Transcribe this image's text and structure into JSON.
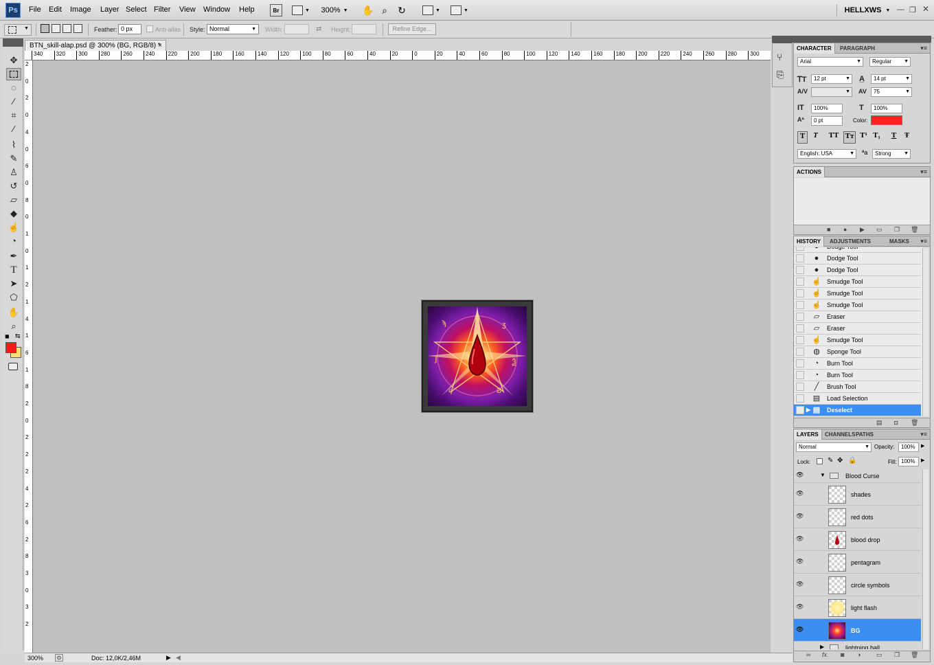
{
  "app": {
    "logo": "Ps",
    "user": "HELLXWS",
    "zoom": "300%"
  },
  "menu": [
    "File",
    "Edit",
    "Image",
    "Layer",
    "Select",
    "Filter",
    "View",
    "Window",
    "Help"
  ],
  "menubar_buttons": {
    "bridge": "Br"
  },
  "options": {
    "feather_label": "Feather:",
    "feather_value": "0 px",
    "antialias_label": "Anti-alias",
    "style_label": "Style:",
    "style_value": "Normal",
    "width_label": "Width:",
    "height_label": "Height:",
    "refine_edge": "Refine Edge..."
  },
  "document": {
    "tab_title": "BTN_skill-alap.psd @ 300% (BG, RGB/8) *",
    "close": "×"
  },
  "ruler": {
    "top": [
      "340",
      "320",
      "300",
      "280",
      "260",
      "240",
      "220",
      "200",
      "180",
      "160",
      "140",
      "120",
      "100",
      "80",
      "60",
      "40",
      "20",
      "0",
      "20",
      "40",
      "60",
      "80",
      "100",
      "120",
      "140",
      "160",
      "180",
      "200",
      "220",
      "240",
      "260",
      "280",
      "300"
    ],
    "left": [
      "2",
      "0",
      "2",
      "0",
      "4",
      "0",
      "6",
      "0",
      "8",
      "0",
      "1",
      "0",
      "1",
      "2",
      "1",
      "4",
      "1",
      "6",
      "1",
      "8",
      "2",
      "0",
      "2",
      "2",
      "2",
      "4",
      "2",
      "6",
      "2",
      "8",
      "3",
      "0",
      "3",
      "2"
    ]
  },
  "status": {
    "zoom": "300%",
    "doc": "Doc: 12,0K/2,46M"
  },
  "colors": {
    "foreground": "#ff1a1a",
    "background": "#ffe070",
    "selection": "#3c8ef0"
  },
  "character": {
    "tabs": [
      "CHARACTER",
      "PARAGRAPH"
    ],
    "font_family": "Arial",
    "font_style": "Regular",
    "size": "12 pt",
    "leading": "14 pt",
    "kerning": "",
    "tracking": "75",
    "vscale": "100%",
    "hscale": "100%",
    "baseline": "0 pt",
    "color_label": "Color:",
    "color": "#ff2020",
    "language": "English: USA",
    "aa_label": "a",
    "antialias": "Strong",
    "style_buttons": [
      "T",
      "T",
      "TT",
      "Tт",
      "T¹",
      "T₁",
      "T",
      "Ŧ"
    ]
  },
  "actions": {
    "tab": "ACTIONS"
  },
  "history": {
    "tabs": [
      "HISTORY",
      "ADJUSTMENTS",
      "MASKS"
    ],
    "items": [
      {
        "icon": "dodge-icon",
        "glyph": "●",
        "label": "Dodge Tool"
      },
      {
        "icon": "dodge-icon",
        "glyph": "●",
        "label": "Dodge Tool"
      },
      {
        "icon": "dodge-icon",
        "glyph": "●",
        "label": "Dodge Tool"
      },
      {
        "icon": "smudge-icon",
        "glyph": "☝",
        "label": "Smudge Tool"
      },
      {
        "icon": "smudge-icon",
        "glyph": "☝",
        "label": "Smudge Tool"
      },
      {
        "icon": "smudge-icon",
        "glyph": "☝",
        "label": "Smudge Tool"
      },
      {
        "icon": "eraser-icon",
        "glyph": "▱",
        "label": "Eraser"
      },
      {
        "icon": "eraser-icon",
        "glyph": "▱",
        "label": "Eraser"
      },
      {
        "icon": "smudge-icon",
        "glyph": "☝",
        "label": "Smudge Tool"
      },
      {
        "icon": "sponge-icon",
        "glyph": "◍",
        "label": "Sponge Tool"
      },
      {
        "icon": "burn-icon",
        "glyph": "◔",
        "label": "Burn Tool"
      },
      {
        "icon": "burn-icon",
        "glyph": "◔",
        "label": "Burn Tool"
      },
      {
        "icon": "brush-icon",
        "glyph": "╱",
        "label": "Brush Tool"
      },
      {
        "icon": "selection-icon",
        "glyph": "▤",
        "label": "Load Selection"
      },
      {
        "icon": "selection-icon",
        "glyph": "▤",
        "label": "Deselect"
      }
    ]
  },
  "layers": {
    "tabs": [
      "LAYERS",
      "CHANNELS",
      "PATHS"
    ],
    "blend_mode": "Normal",
    "opacity_label": "Opacity:",
    "opacity": "100%",
    "lock_label": "Lock:",
    "fill_label": "Fill:",
    "fill": "100%",
    "group": "Blood Curse",
    "items": [
      "shades",
      "red dots",
      "blood drop",
      "pentagram",
      "circle symbols",
      "light flash",
      "BG"
    ],
    "next_group": "lightning ball",
    "footer": "fx."
  }
}
